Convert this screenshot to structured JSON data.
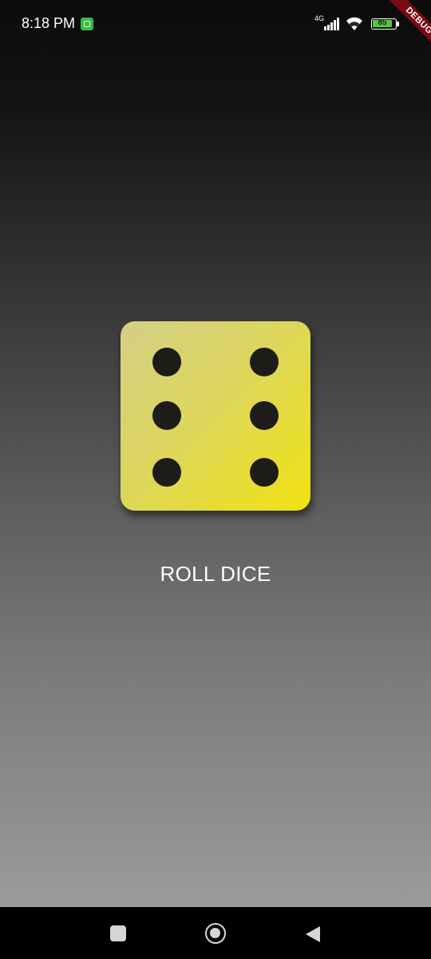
{
  "status_bar": {
    "time": "8:18 PM",
    "network_type": "4G",
    "battery_level": "85",
    "icons": [
      "app-notification-icon",
      "signal-icon",
      "wifi-icon",
      "battery-icon"
    ]
  },
  "debug_banner": {
    "label": "DEBUG"
  },
  "dice": {
    "face_value": 6,
    "colors": {
      "face_start": "#d4cf86",
      "face_end": "#f1e212",
      "pip": "#1d1c19"
    }
  },
  "action": {
    "roll_label": "ROLL DICE"
  },
  "nav_bar": {
    "icons": [
      "recents-icon",
      "home-icon",
      "back-icon"
    ]
  },
  "theme": {
    "background_top": "#0b0b0b",
    "background_bottom": "#9b9b9b",
    "accent": "#f1e212"
  }
}
